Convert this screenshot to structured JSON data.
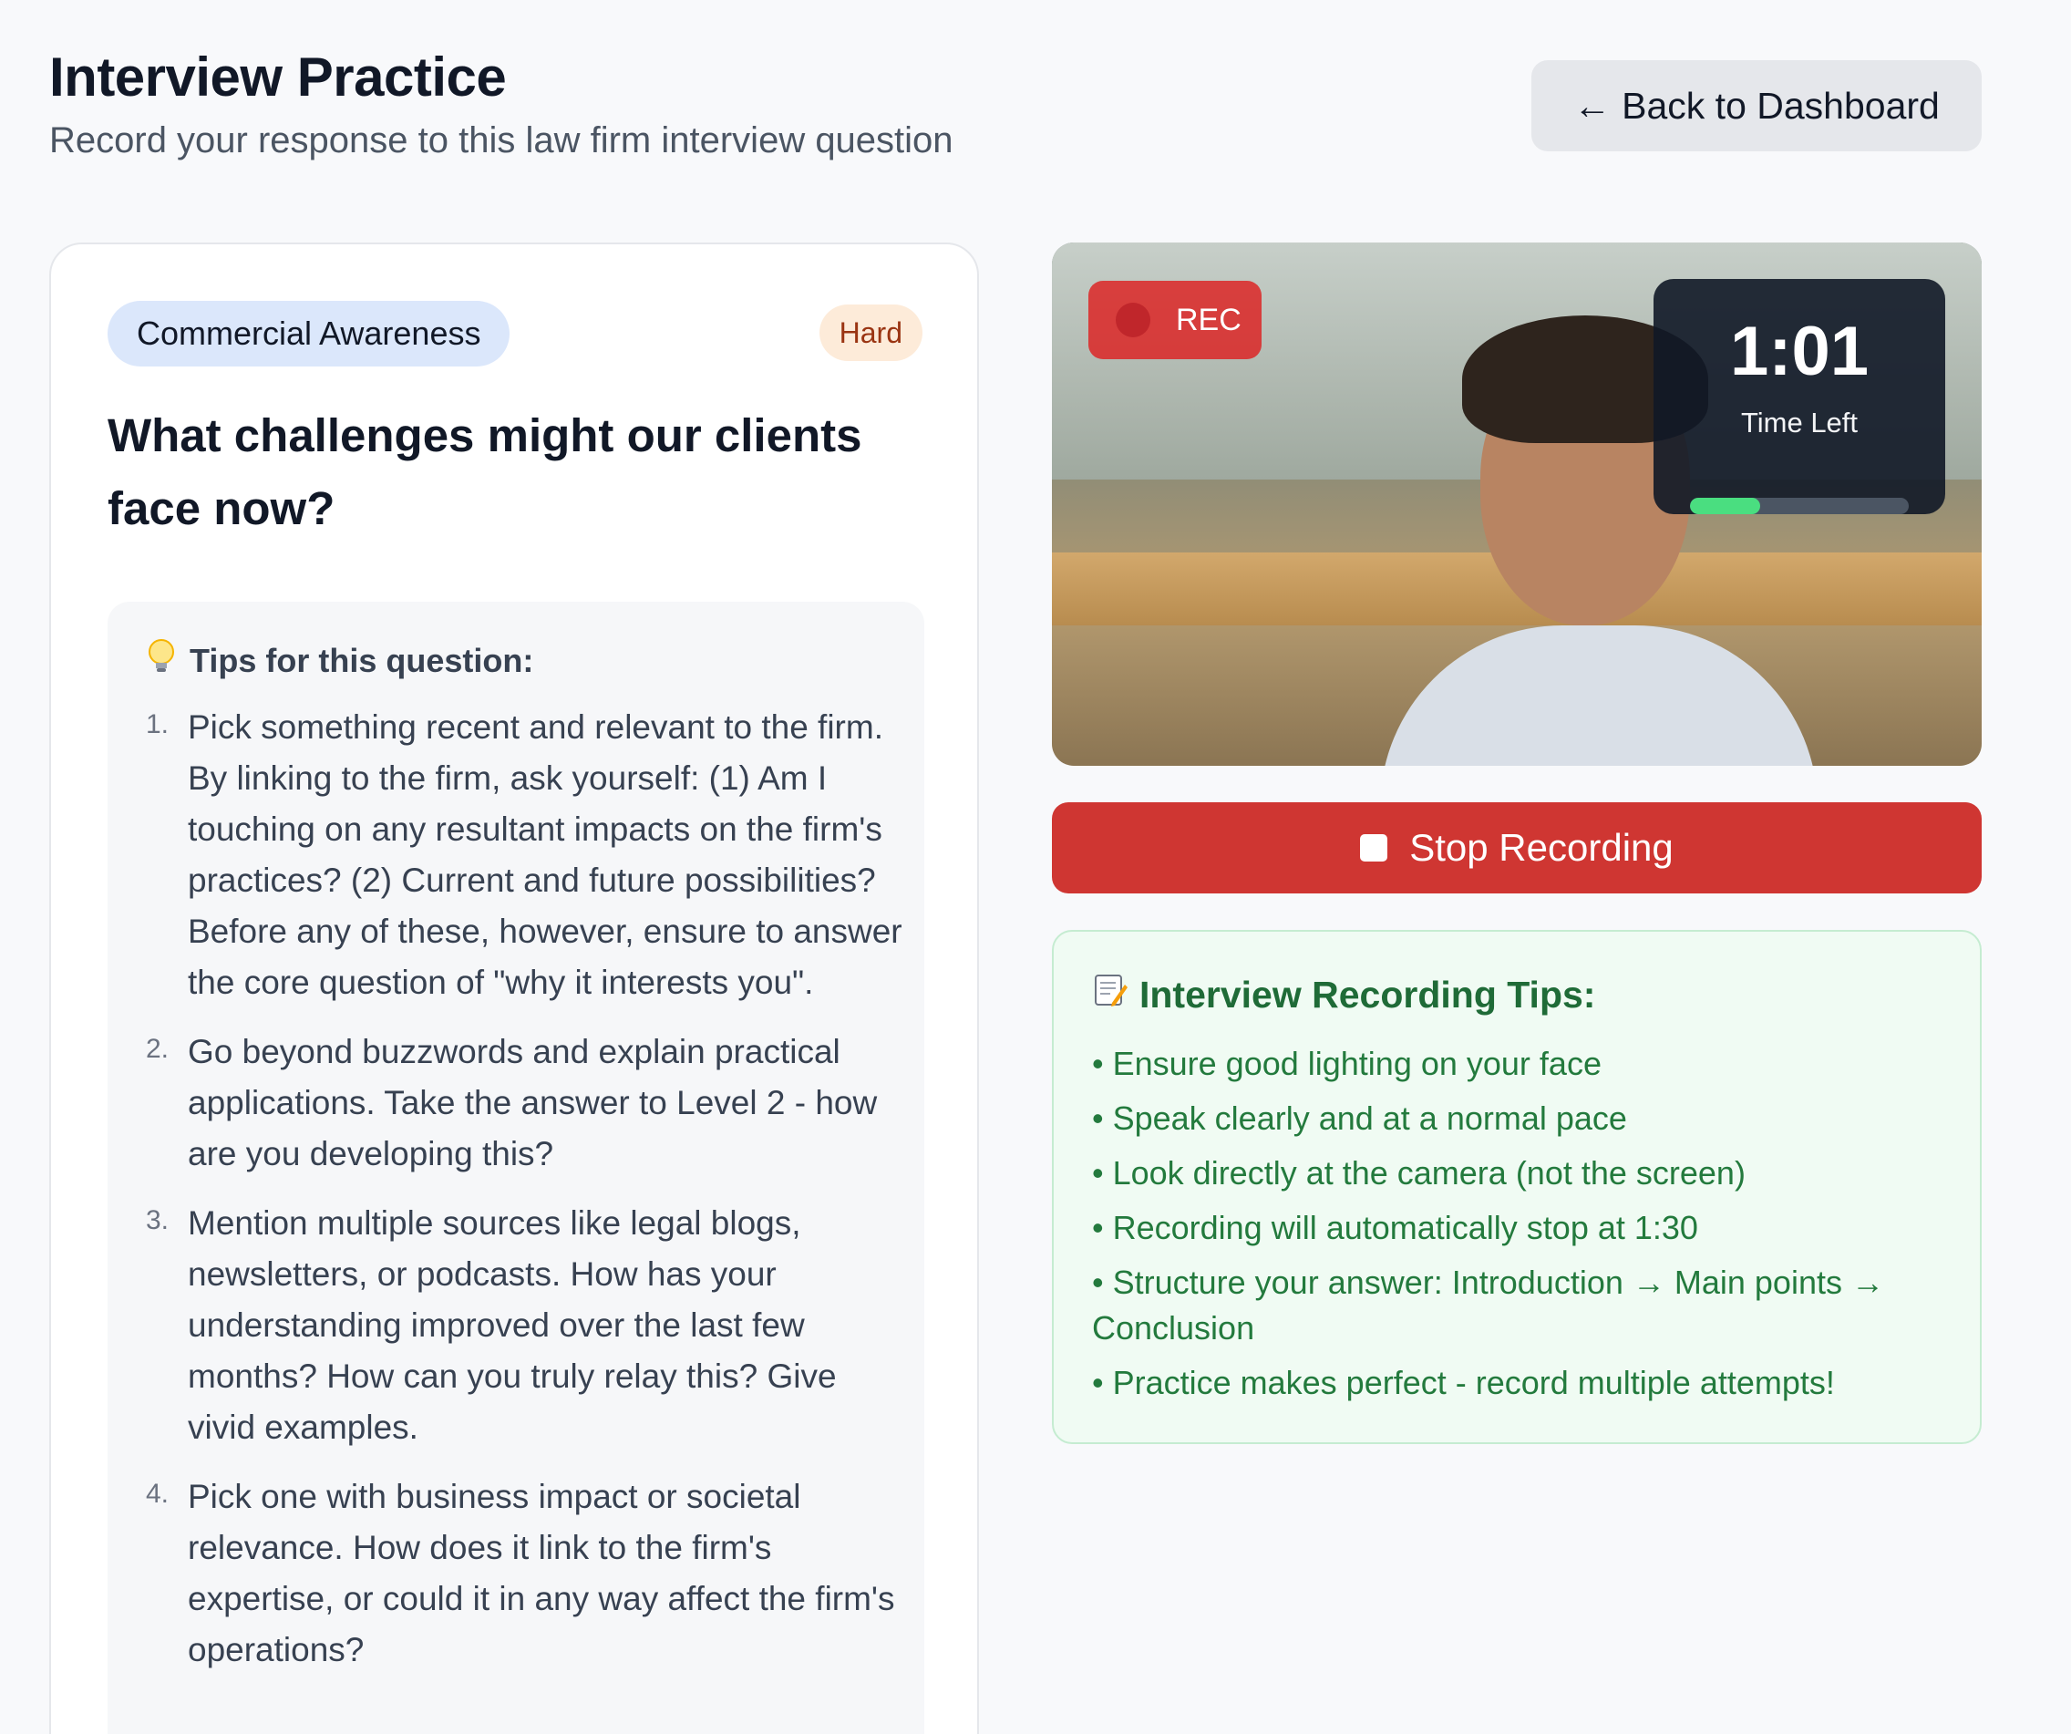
{
  "header": {
    "title": "Interview Practice",
    "subtitle": "Record your response to this law firm interview question",
    "back_button": {
      "arrow": "←",
      "label": "Back to Dashboard"
    }
  },
  "question": {
    "category": "Commercial Awareness",
    "difficulty": "Hard",
    "text": "What challenges might our clients face now?",
    "tips_heading": "Tips for this question:",
    "tips_icon": "lightbulb-icon",
    "tips": [
      {
        "num": "1.",
        "text": "Pick something recent and relevant to the firm. By linking to the firm, ask yourself: (1) Am I touching on any resultant impacts on the firm's practices? (2) Current and future possibilities? Before any of these, however, ensure to answer the core question of \"why it interests you\"."
      },
      {
        "num": "2.",
        "text": "Go beyond buzzwords and explain practical applications. Take the answer to Level 2 - how are you developing this?"
      },
      {
        "num": "3.",
        "text": "Mention multiple sources like legal blogs, newsletters, or podcasts. How has your understanding improved over the last few months? How can you truly relay this? Give vivid examples."
      },
      {
        "num": "4.",
        "text": "Pick one with business impact or societal relevance. How does it link to the firm's expertise, or could it in any way affect the firm's operations?"
      }
    ]
  },
  "recording": {
    "rec_label": "REC",
    "timer_value": "1:01",
    "timer_label": "Time Left",
    "time_progress_fraction": 0.32,
    "stop_button_label": "Stop Recording"
  },
  "recording_tips": {
    "heading": "Interview Recording Tips:",
    "icon": "memo-icon",
    "items": [
      "• Ensure good lighting on your face",
      "• Speak clearly and at a normal pace",
      "• Look directly at the camera (not the screen)",
      "• Recording will automatically stop at 1:30",
      "• Structure your answer: Introduction → Main points → Conclusion",
      "• Practice makes perfect - record multiple attempts!"
    ]
  },
  "colors": {
    "accent_red": "#cf3632",
    "badge_blue": "#dbe7fb",
    "tips_green": "#237a3d",
    "timer_green": "#4ade80"
  }
}
